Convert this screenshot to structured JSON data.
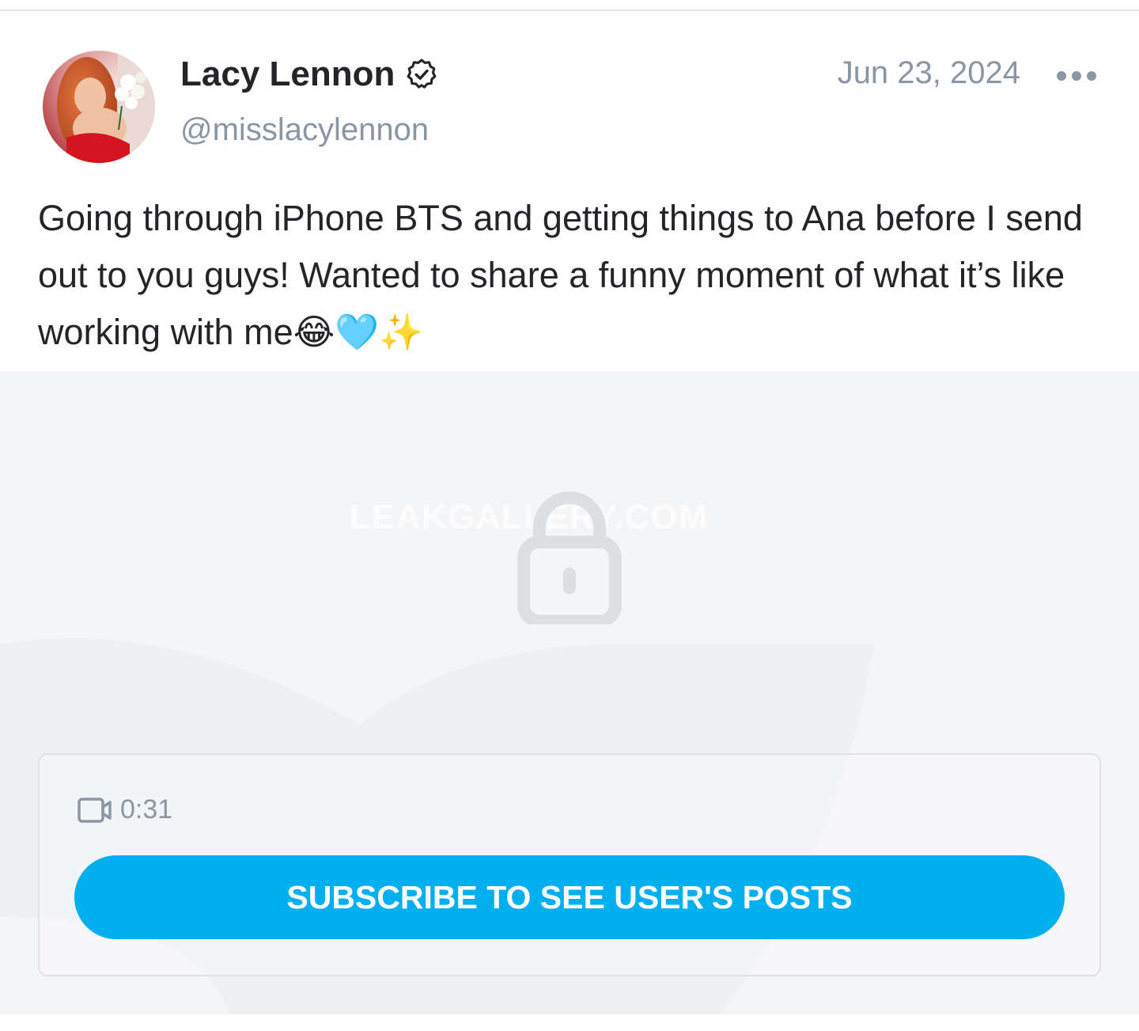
{
  "post": {
    "author": {
      "display_name": "Lacy Lennon",
      "handle": "@misslacylennon",
      "verified_icon": "verified-badge-icon",
      "avatar": "avatar-photo"
    },
    "date": "Jun 23, 2024",
    "more_icon": "more-dots-icon",
    "text": "Going through iPhone BTS and getting things to Ana before I send out to you guys! Wanted to share a funny moment of what it’s like working with me😂🩵✨"
  },
  "media": {
    "watermark": "LEAKGALLERY.COM",
    "lock_icon": "lock-icon",
    "media_type_icon": "video-camera-icon",
    "duration": "0:31",
    "subscribe_label": "SUBSCRIBE TO SEE USER'S POSTS"
  },
  "colors": {
    "accent": "#00aff0",
    "text_primary": "#242529",
    "text_secondary": "#8a96a3",
    "media_background": "#f4f5f7"
  }
}
